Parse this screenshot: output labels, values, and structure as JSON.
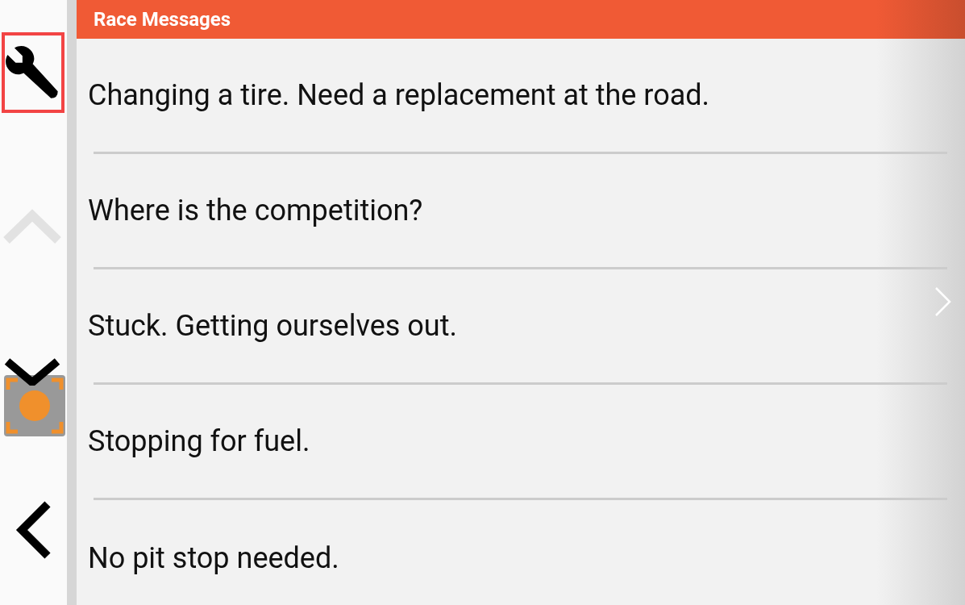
{
  "sidebar": {
    "tools": [
      {
        "kind": "wrench",
        "selected": true
      },
      {
        "kind": "up",
        "disabled": true
      },
      {
        "kind": "down",
        "disabled": false
      },
      {
        "kind": "locate"
      },
      {
        "kind": "back",
        "disabled": false
      }
    ]
  },
  "panel": {
    "title": "Race Messages",
    "messages": [
      "Changing a tire. Need a replacement at the road.",
      "Where is the competition?",
      "Stuck. Getting ourselves out.",
      "Stopping for fuel.",
      "No pit stop needed."
    ]
  }
}
